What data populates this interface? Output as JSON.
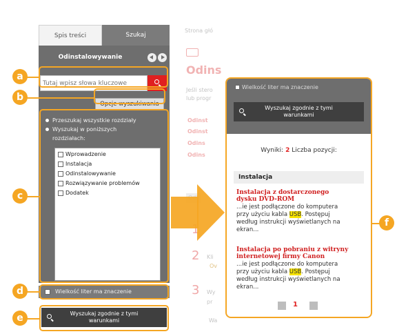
{
  "left_panel": {
    "tab_toc": "Spis treści",
    "tab_search": "Szukaj",
    "title": "Odinstalowywanie",
    "search_placeholder": "Tutaj wpisz słowa kluczowe",
    "options_button": "Opcje wyszukiwania",
    "radio_all": "Przeszukaj wszystkie rozdziały",
    "radio_selected_line1": "Wyszukaj w poniższych",
    "radio_selected_line2": "rozdziałach:",
    "chapters": [
      "Wprowadzenie",
      "Instalacja",
      "Odinstalowywanie",
      "Rozwiązywanie problemów",
      "Dodatek"
    ],
    "case_sensitive": "Wielkość liter ma znaczenie",
    "search_button_line1": "Wyszukaj zgodnie z tymi",
    "search_button_line2": "warunkami"
  },
  "background_page": {
    "breadcrumb": "Strona głó",
    "heading": "Odins",
    "text_line1": "Jeśli stero",
    "text_line2": "lub progr",
    "links": [
      "Odinst",
      "Odinst",
      "Odins",
      "Odins"
    ],
    "steps": [
      "1",
      "2",
      "3"
    ],
    "step_texts": [
      "Kli",
      "Ov",
      "Wy",
      "pr"
    ],
    "other": [
      "Odi",
      "Wa"
    ]
  },
  "results_panel": {
    "case_sensitive": "Wielkość liter ma znaczenie",
    "search_button_line1": "Wyszukaj zgodnie z tymi",
    "search_button_line2": "warunkami",
    "results_label": "Wyniki:",
    "results_count": "2",
    "results_suffix": "Liczba pozycji:",
    "section": "Instalacja",
    "result1_title_line1": "Instalacja z dostarczonego",
    "result1_title_line2": "dysku DVD-ROM",
    "result1_snip_line1": "...ie jest podłączone do komputera",
    "result1_snip_line2_a": "przy użyciu kabla ",
    "result1_snip_line2_hl": "USB",
    "result1_snip_line2_b": ". Postępuj",
    "result1_snip_line3": "według instrukcji wyświetlanych na",
    "result1_snip_line4": "ekran...",
    "result2_title_line1": "Instalacja po pobraniu z witryny",
    "result2_title_line2": "internetowej firmy Canon",
    "result2_snip_line1": "...ie jest podłączone do komputera",
    "result2_snip_line2_a": "przy użyciu kabla ",
    "result2_snip_line2_hl": "USB",
    "result2_snip_line2_b": ". Postępuj",
    "result2_snip_line3": "według instrukcji wyświetlanych na",
    "result2_snip_line4": "ekran...",
    "page_number": "1"
  },
  "callouts": {
    "a": "a",
    "b": "b",
    "c": "c",
    "d": "d",
    "e": "e",
    "f": "f"
  },
  "colors": {
    "accent": "#f5a623",
    "red": "#e02020",
    "panel_gray": "#6e6e6e",
    "dark_button": "#3f3f3f",
    "highlight": "#f7e300"
  }
}
